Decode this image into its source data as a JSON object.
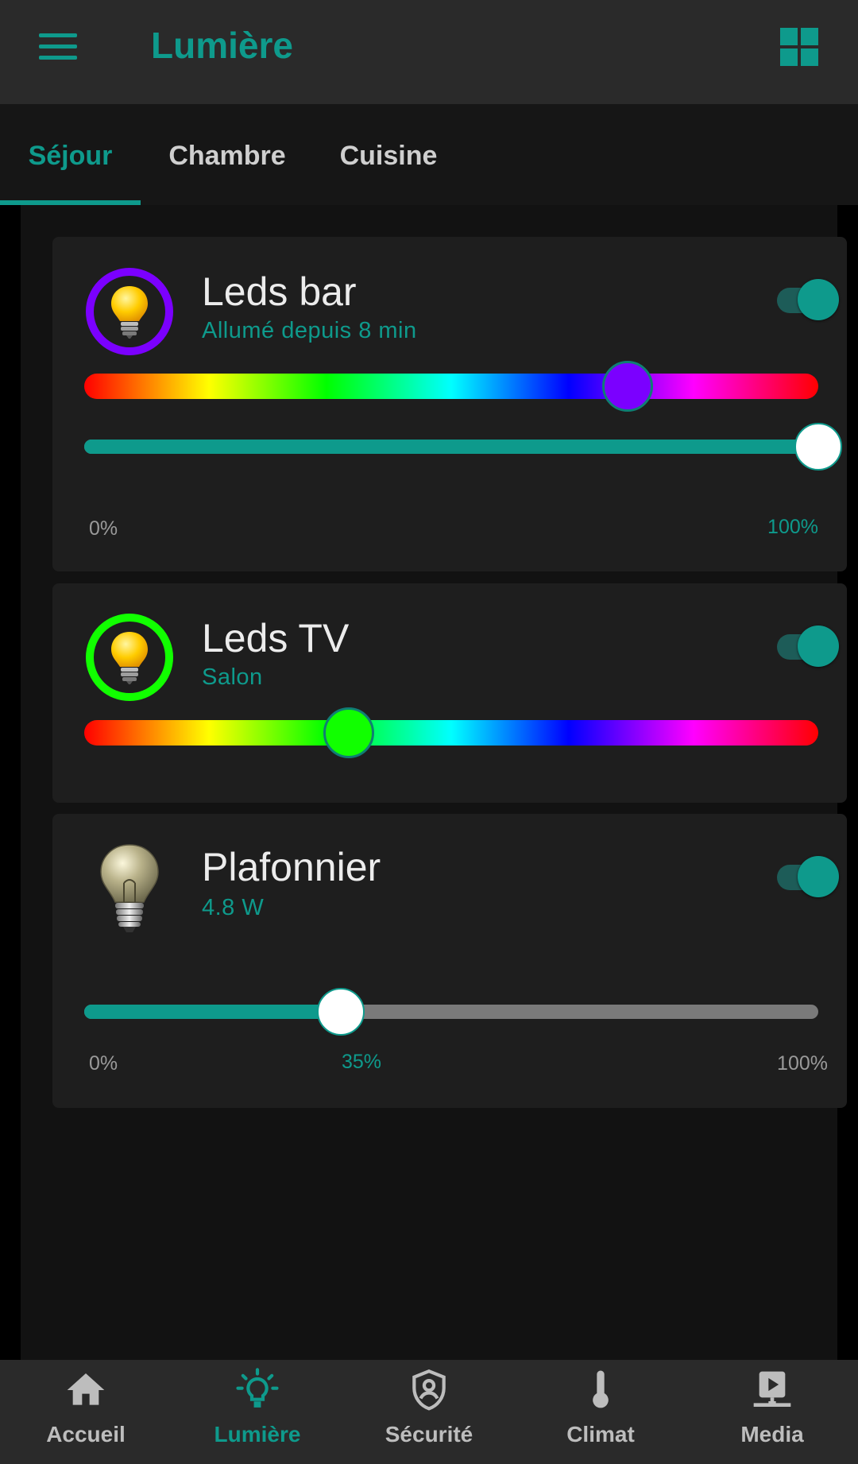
{
  "app": {
    "title": "Lumière"
  },
  "tabs": [
    {
      "label": "Séjour",
      "active": true
    },
    {
      "label": "Chambre",
      "active": false
    },
    {
      "label": "Cuisine",
      "active": false
    }
  ],
  "colors": {
    "accent": "#0e9a8c",
    "leds_bar_color": "#7b00ff",
    "leds_tv_color": "#11ff00"
  },
  "cards": [
    {
      "title": "Leds bar",
      "subtitle": "Allumé depuis 8 min",
      "on": true,
      "icon": "lightbulb-icon",
      "hue_fraction": 0.74,
      "brightness": {
        "min": "0%",
        "max": "100%",
        "value_percent": 100
      }
    },
    {
      "title": "Leds TV",
      "subtitle": "Salon",
      "on": true,
      "icon": "lightbulb-icon",
      "hue_fraction": 0.36
    },
    {
      "title": "Plafonnier",
      "subtitle": "4.8 W",
      "on": true,
      "icon": "incandescent-bulb-icon",
      "brightness": {
        "min": "0%",
        "max": "100%",
        "value_label": "35%",
        "value_percent": 35
      }
    }
  ],
  "bottom_nav": [
    {
      "label": "Accueil",
      "icon": "home-icon",
      "active": false
    },
    {
      "label": "Lumière",
      "icon": "lightbulb-outline-icon",
      "active": true
    },
    {
      "label": "Sécurité",
      "icon": "shield-account-icon",
      "active": false
    },
    {
      "label": "Climat",
      "icon": "thermometer-icon",
      "active": false
    },
    {
      "label": "Media",
      "icon": "media-play-icon",
      "active": false
    }
  ]
}
